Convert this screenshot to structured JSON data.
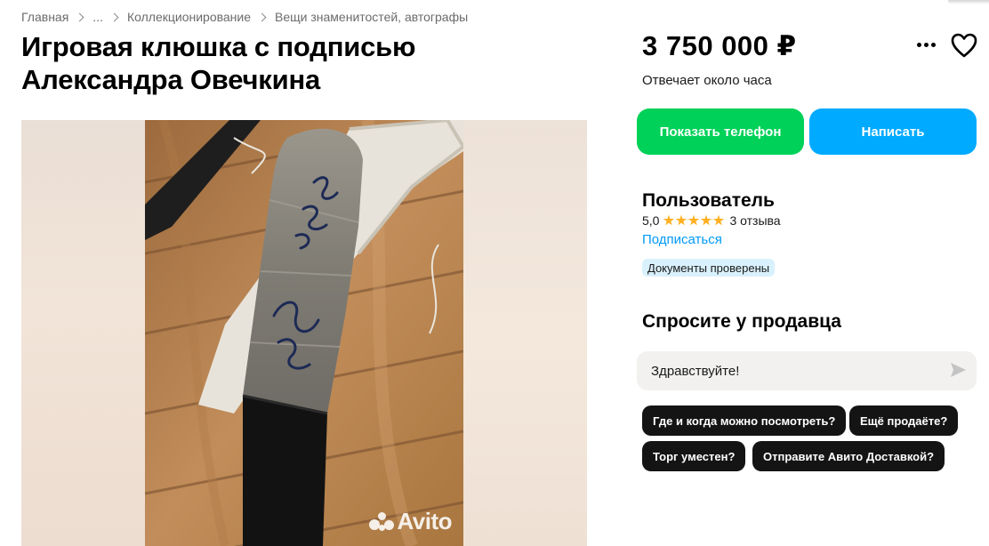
{
  "breadcrumb": {
    "items": [
      "Главная",
      "...",
      "Коллекционирование",
      "Вещи знаменитостей, автографы"
    ]
  },
  "listing": {
    "title": "Игровая клюшка с подписью Александра Овечкина",
    "price": "3 750 000 ₽",
    "response_time": "Отвечает около часа"
  },
  "gallery": {
    "watermark": "Avito",
    "photo_description_icon": "hockey-stick-photo"
  },
  "actions": {
    "more_icon": "more-dots-icon",
    "favorite_icon": "heart-icon",
    "show_phone": "Показать телефон",
    "write": "Написать"
  },
  "seller": {
    "name": "Пользователь",
    "rating": "5,0",
    "stars": 5,
    "reviews": "3 отзыва",
    "subscribe": "Подписаться",
    "badge": "Документы проверены"
  },
  "ask": {
    "title": "Спросите у продавца",
    "input_value": "Здравствуйте!",
    "send_icon": "send-arrow-icon",
    "quick_questions": [
      "Где и когда можно посмотреть?",
      "Ещё продаёте?",
      "Торг уместен?",
      "Отправите Авито Доставкой?"
    ]
  },
  "colors": {
    "phone_button": "#00d158",
    "write_button": "#00aaff",
    "link": "#0099f7",
    "badge_bg": "#d9f1fc",
    "chip_bg": "#141414",
    "star": "#ffb021"
  }
}
